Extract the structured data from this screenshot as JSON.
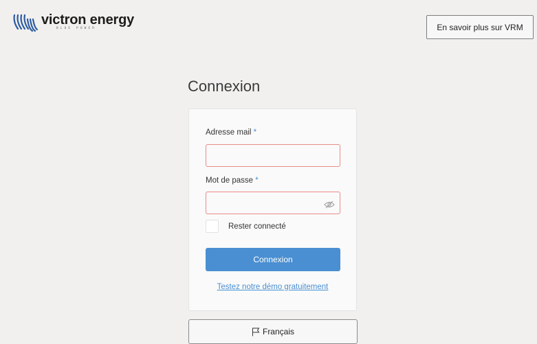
{
  "header": {
    "logo_name": "victron energy",
    "logo_tagline": "BLUE POWER",
    "vrm_button_label": "En savoir plus sur VRM"
  },
  "login": {
    "title": "Connexion",
    "email_label": "Adresse mail",
    "email_value": "",
    "password_label": "Mot de passe",
    "password_value": "",
    "required_marker": "*",
    "remember_label": "Rester connecté",
    "remember_checked": false,
    "submit_label": "Connexion",
    "demo_link": "Testez notre démo gratuitement"
  },
  "language": {
    "label": "Français"
  },
  "icons": {
    "password_toggle": "eye-slash-icon",
    "language": "flag-icon",
    "logo": "victron-logo-icon"
  },
  "colors": {
    "accent": "#4a8fd1",
    "error_border": "#e88a86",
    "background": "#f1f0ef",
    "logo_blue": "#2c5aa0"
  }
}
